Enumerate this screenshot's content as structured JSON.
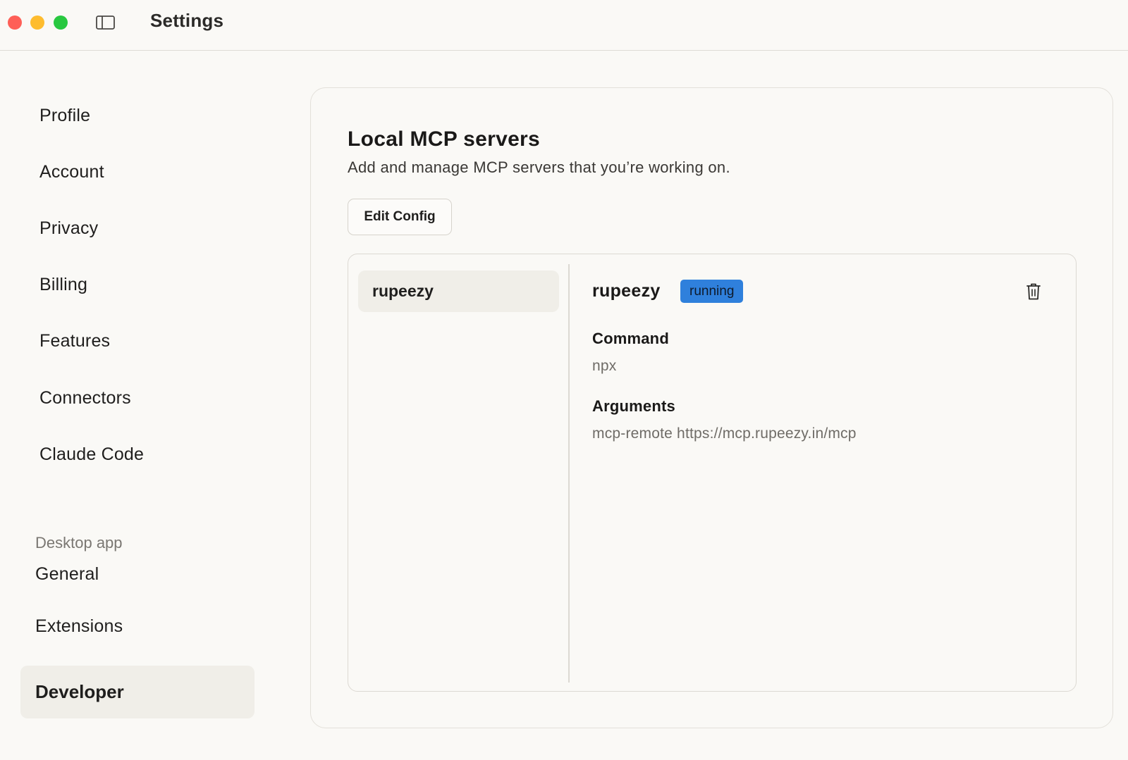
{
  "window": {
    "title": "Settings"
  },
  "sidebar": {
    "items": [
      {
        "label": "Profile"
      },
      {
        "label": "Account"
      },
      {
        "label": "Privacy"
      },
      {
        "label": "Billing"
      },
      {
        "label": "Features"
      },
      {
        "label": "Connectors"
      },
      {
        "label": "Claude Code"
      }
    ],
    "section_label": "Desktop app",
    "desktop_items": [
      {
        "label": "General"
      },
      {
        "label": "Extensions"
      },
      {
        "label": "Developer",
        "active": true
      }
    ]
  },
  "main": {
    "title": "Local MCP servers",
    "subtitle": "Add and manage MCP servers that you’re working on.",
    "edit_config_label": "Edit Config",
    "servers": [
      {
        "name": "rupeezy",
        "selected": true
      }
    ],
    "detail": {
      "name": "rupeezy",
      "status": "running",
      "status_color": "#2f80dc",
      "command_label": "Command",
      "command_value": "npx",
      "arguments_label": "Arguments",
      "arguments_value": "mcp-remote https://mcp.rupeezy.in/mcp",
      "delete_icon": "trash-icon"
    }
  }
}
